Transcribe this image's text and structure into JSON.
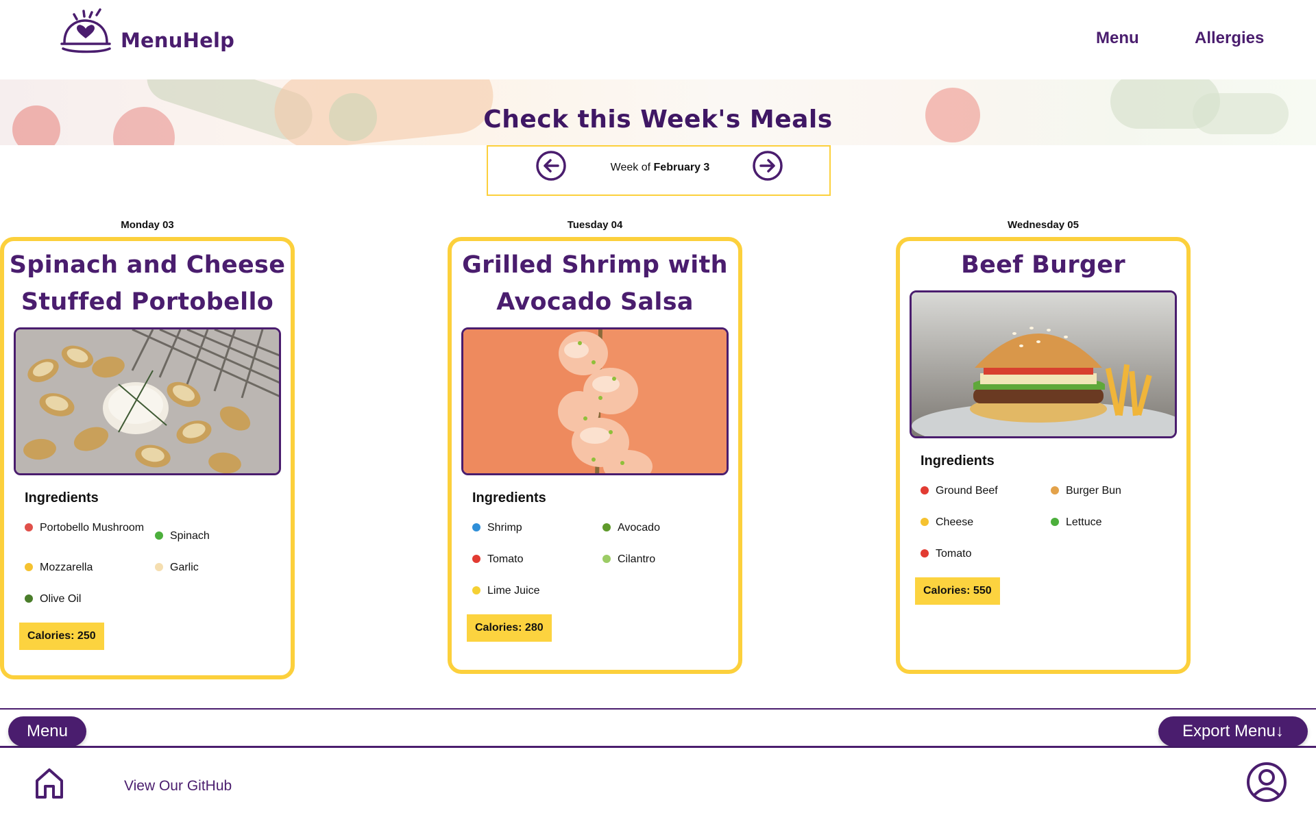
{
  "brand": {
    "name": "MenuHelp"
  },
  "nav": {
    "menu": "Menu",
    "allergies": "Allergies"
  },
  "hero": {
    "title": "Check this Week's Meals"
  },
  "week": {
    "prefix": "Week of ",
    "date": "February 3"
  },
  "days": [
    {
      "day_label": "Monday 03",
      "meal_title": "Spinach and Cheese Stuffed Portobello",
      "ingredients_title": "Ingredients",
      "ingredients": [
        "Portobello Mushroom",
        "Spinach",
        "Mozzarella",
        "Garlic",
        "Olive Oil"
      ],
      "calories": "Calories: 250"
    },
    {
      "day_label": "Tuesday 04",
      "meal_title": "Grilled Shrimp with Avocado Salsa",
      "ingredients_title": "Ingredients",
      "ingredients": [
        "Shrimp",
        "Avocado",
        "Tomato",
        "Cilantro",
        "Lime Juice"
      ],
      "calories": "Calories: 280"
    },
    {
      "day_label": "Wednesday 05",
      "meal_title": "Beef Burger",
      "ingredients_title": "Ingredients",
      "ingredients": [
        "Ground Beef",
        "Burger Bun",
        "Cheese",
        "Lettuce",
        "Tomato"
      ],
      "calories": "Calories: 550"
    }
  ],
  "bottom_bar": {
    "menu": "Menu",
    "export": "Export Menu↓"
  },
  "footer": {
    "github": "View Our GitHub"
  },
  "colors": {
    "brand": "#4a1d6e",
    "accent": "#fcd03c",
    "white": "#ffffff"
  },
  "icons": {
    "logo": "cloche-heart-icon",
    "prev": "arrow-left-circle-icon",
    "next": "arrow-right-circle-icon",
    "home": "home-icon",
    "user": "user-circle-icon"
  }
}
